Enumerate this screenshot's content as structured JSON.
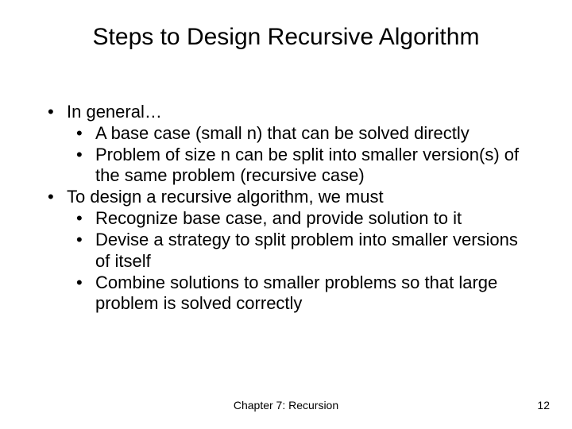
{
  "title": "Steps to Design Recursive Algorithm",
  "bullets": {
    "item0": {
      "text": "In general…",
      "sub": {
        "s0": "A base case (small n) that can be solved directly",
        "s1": "Problem of size n can be split into smaller version(s) of the same problem (recursive case)"
      }
    },
    "item1": {
      "text": "To design a recursive algorithm, we must",
      "sub": {
        "s0": "Recognize base case, and provide solution to it",
        "s1": "Devise a strategy to split problem into smaller versions of itself",
        "s2": "Combine solutions to smaller problems so that large problem is solved correctly"
      }
    }
  },
  "footer": {
    "center": "Chapter 7: Recursion",
    "page": "12"
  }
}
